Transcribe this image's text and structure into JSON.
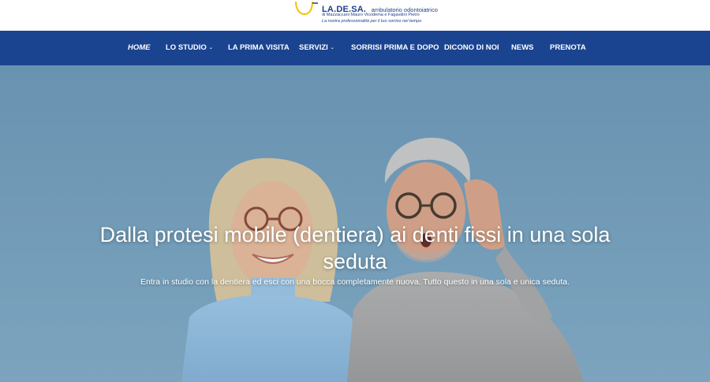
{
  "logo": {
    "brand": "LA.DE.SA.",
    "tagline": "ambulatorio odontoiatrico",
    "owners": "di Mazzaccani Mauro Vicodema e Fagavdini Pietro",
    "motto": "La nostra professionalità per il tuo sorriso nel tempo",
    "colors": {
      "text": "#1f3f8a",
      "accent": "#f2c200"
    }
  },
  "nav": {
    "background": "#1b4490",
    "items": [
      {
        "label": "HOME",
        "active": true,
        "dropdown": false
      },
      {
        "label": "LO STUDIO",
        "active": false,
        "dropdown": true
      },
      {
        "label": "LA PRIMA VISITA",
        "active": false,
        "dropdown": false
      },
      {
        "label": "SERVIZI",
        "active": false,
        "dropdown": true
      },
      {
        "label": "SORRISI PRIMA E DOPO",
        "active": false,
        "dropdown": false
      },
      {
        "label": "DICONO DI NOI",
        "active": false,
        "dropdown": false
      },
      {
        "label": "NEWS",
        "active": false,
        "dropdown": false
      },
      {
        "label": "PRENOTA",
        "active": false,
        "dropdown": false
      }
    ],
    "caret_icon": "chevron-down-icon"
  },
  "hero": {
    "title": "Dalla protesi mobile (dentiera) ai denti fissi in una sola seduta",
    "subtitle": "Entra in studio con la dentiera ed esci con una bocca completamente nuova. Tutto questo in una sola e unica seduta.",
    "background": "#78a2bf"
  }
}
